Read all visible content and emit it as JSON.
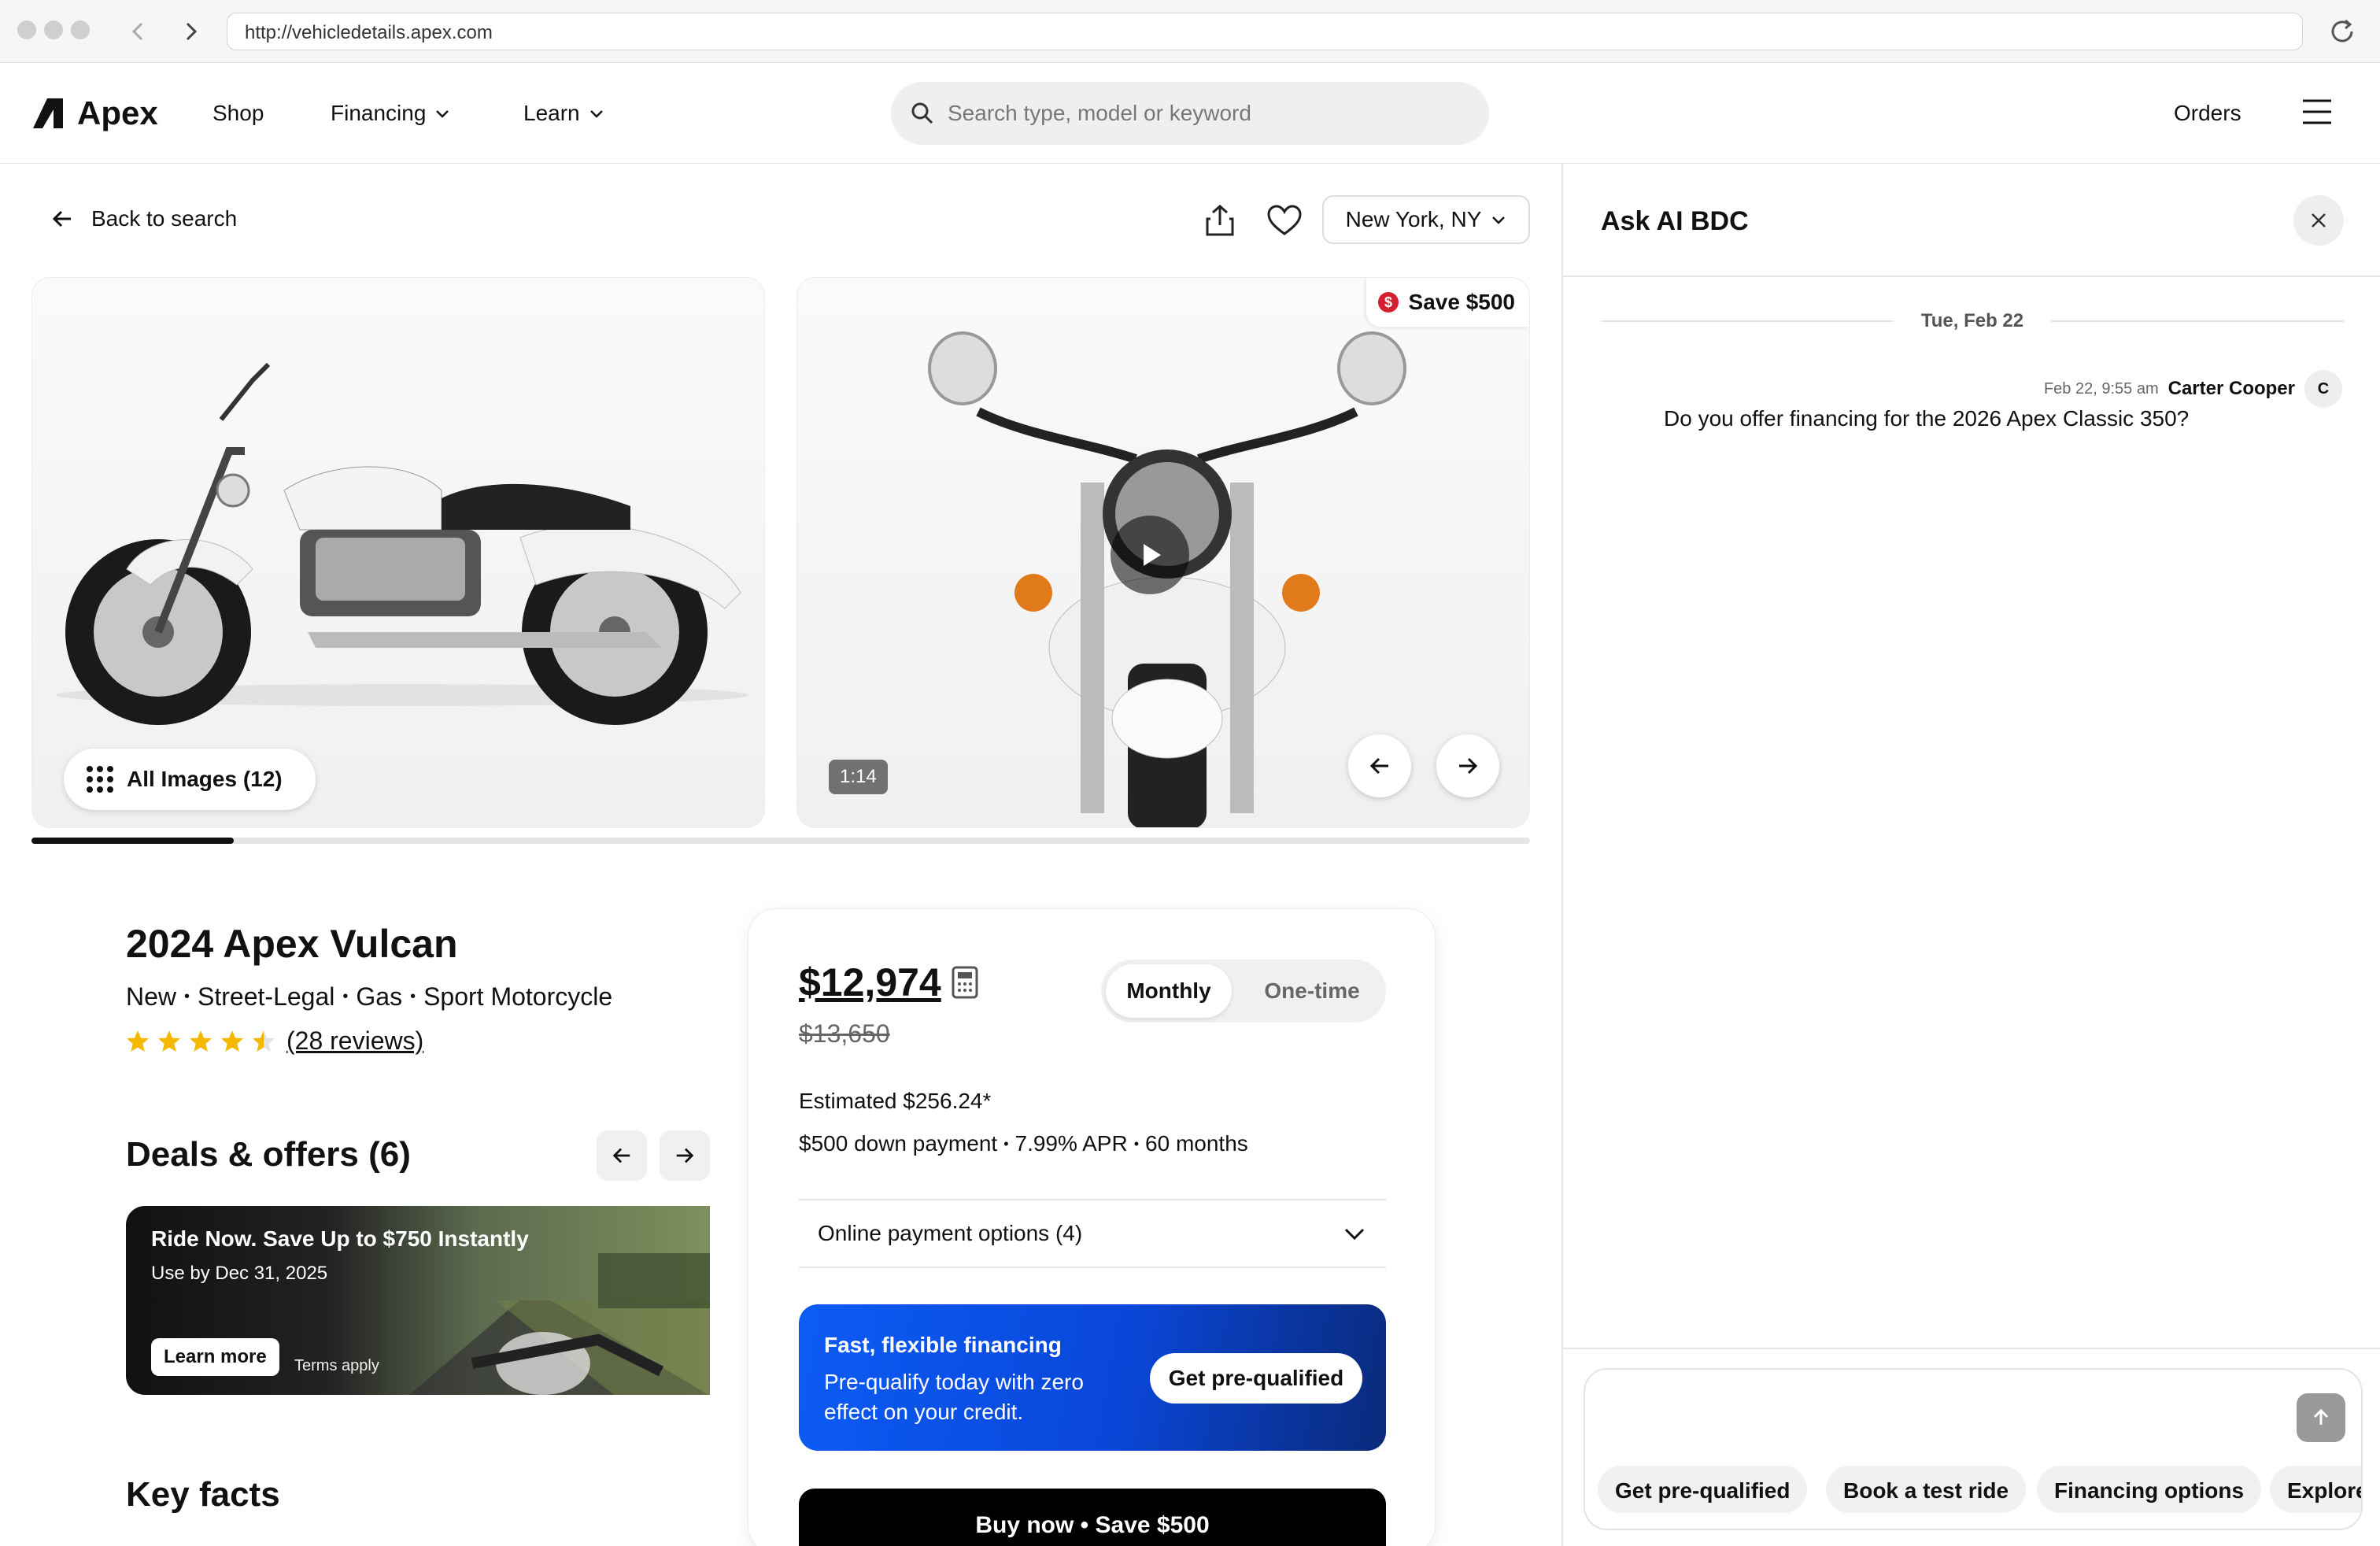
{
  "browser": {
    "url": "http://vehicledetails.apex.com"
  },
  "nav": {
    "brand": "Apex",
    "links": [
      "Shop",
      "Financing",
      "Learn"
    ],
    "search_placeholder": "Search type, model or keyword",
    "orders": "Orders"
  },
  "toolbar": {
    "back": "Back to search",
    "location": "New York, NY"
  },
  "gallery": {
    "all_images": "All Images (12)",
    "save_badge": "Save $500",
    "video_duration": "1:14",
    "progress": 0.135
  },
  "vehicle": {
    "title": "2024 Apex Vulcan",
    "tags": [
      "New",
      "Street-Legal",
      "Gas",
      "Sport Motorcycle"
    ],
    "rating": 4.5,
    "reviews": "(28 reviews)"
  },
  "deals": {
    "title": "Deals & offers (6)",
    "offer_title": "Ride Now. Save Up to $750 Instantly",
    "offer_date": "Use by Dec 31, 2025",
    "learn_more": "Learn more",
    "terms": "Terms apply"
  },
  "key_facts": "Key facts",
  "pricing": {
    "price": "$12,974",
    "old_price": "$13,650",
    "toggle": [
      "Monthly",
      "One-time"
    ],
    "estimated": "Estimated $256.24*",
    "terms": [
      "$500 down payment",
      "7.99% APR",
      "60 months"
    ],
    "payment_options": "Online payment options (4)",
    "financing_title": "Fast, flexible financing",
    "financing_text": "Pre-qualify today with zero effect on your credit.",
    "prequalify": "Get pre-qualified",
    "buy": "Buy now • Save $500"
  },
  "chat": {
    "title": "Ask AI BDC",
    "date": "Tue, Feb 22",
    "timestamp": "Feb 22, 9:55 am",
    "user": "Carter Cooper",
    "user_initial": "C",
    "message": "Do you offer financing for the 2026 Apex Classic 350?",
    "chips": [
      "Get pre-qualified",
      "Book a test ride",
      "Financing options",
      "Explore"
    ]
  },
  "colors": {
    "financing_start": "#0c5cf5",
    "financing_end": "#0a2a7a",
    "star": "#f5b800",
    "save_badge_icon": "#d3202f"
  }
}
